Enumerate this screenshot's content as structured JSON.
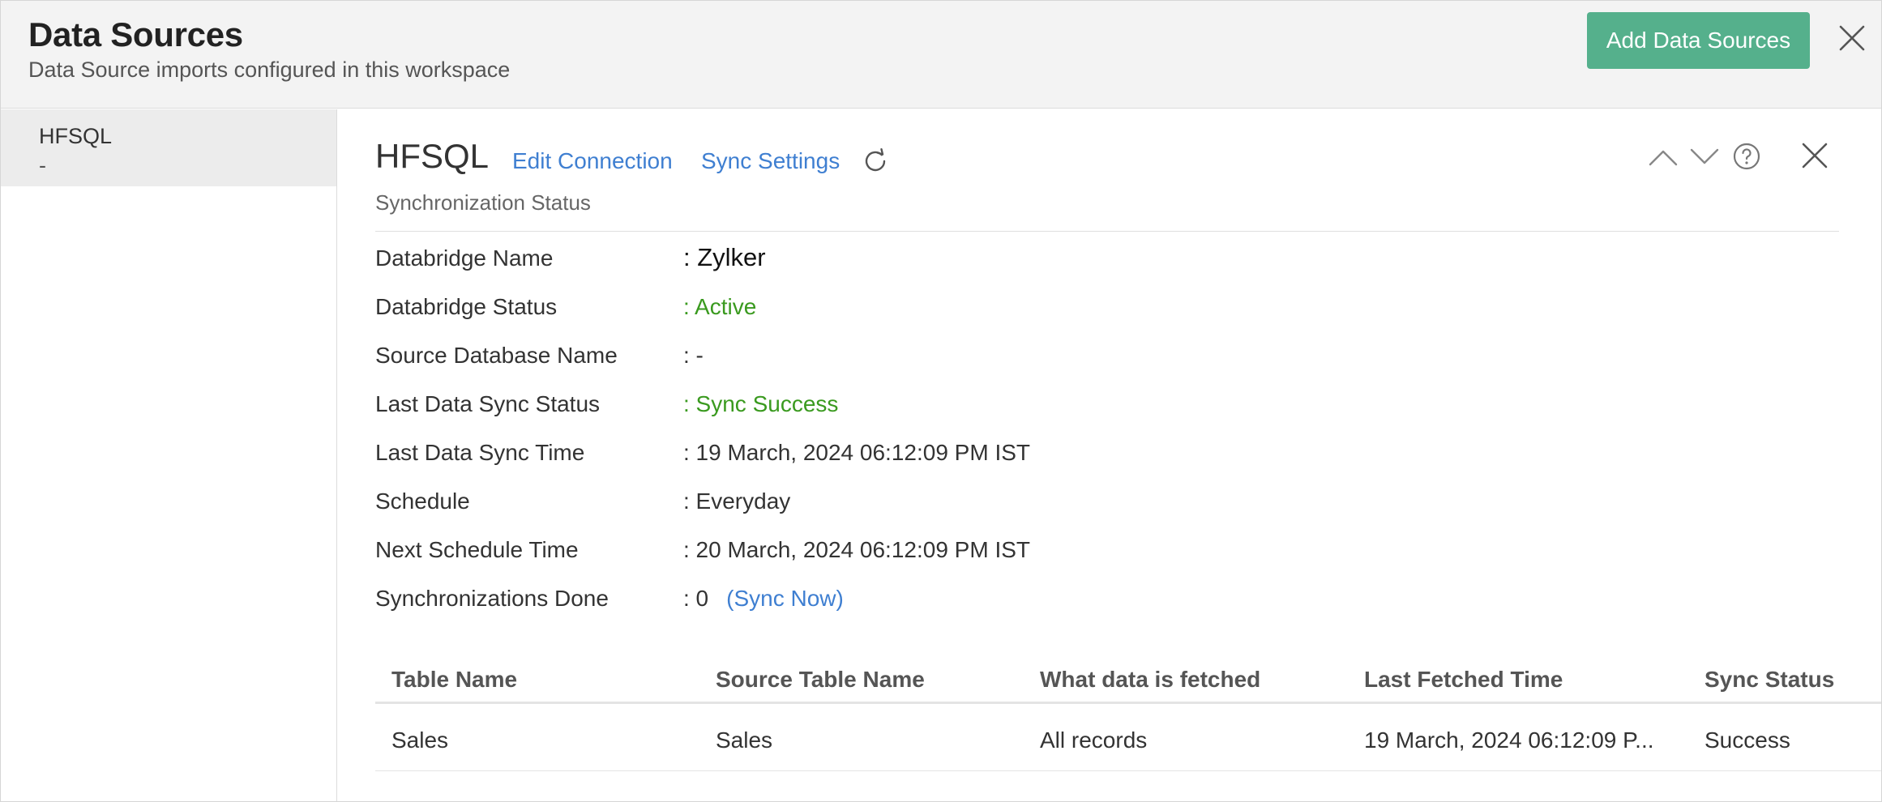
{
  "header": {
    "title": "Data Sources",
    "subtitle": "Data Source imports configured in this workspace",
    "add_button_label": "Add Data Sources"
  },
  "sidebar": {
    "items": [
      {
        "name": "HFSQL",
        "sub": "-"
      }
    ]
  },
  "panel": {
    "title": "HFSQL",
    "edit_connection": "Edit Connection",
    "sync_settings": "Sync Settings",
    "section_label": "Synchronization Status",
    "details": {
      "databridge_name": {
        "label": "Databridge Name",
        "value": ": Zylker"
      },
      "databridge_status": {
        "label": "Databridge Status",
        "value": ": Active"
      },
      "source_db_name": {
        "label": "Source Database Name",
        "value": ": -"
      },
      "last_sync_status": {
        "label": "Last Data Sync Status",
        "value": ": Sync Success"
      },
      "last_sync_time": {
        "label": "Last Data Sync Time",
        "value": ": 19 March, 2024 06:12:09 PM IST"
      },
      "schedule": {
        "label": "Schedule",
        "value": ": Everyday"
      },
      "next_schedule_time": {
        "label": "Next Schedule Time",
        "value": ": 20 March, 2024 06:12:09 PM IST"
      },
      "syncs_done": {
        "label": "Synchronizations Done",
        "value": ": 0",
        "sync_now": "(Sync Now)"
      }
    },
    "table": {
      "columns": [
        "Table Name",
        "Source Table Name",
        "What data is fetched",
        "Last Fetched Time",
        "Sync Status"
      ],
      "rows": [
        [
          "Sales",
          "Sales",
          "All records",
          "19 March, 2024 06:12:09 P...",
          "Success"
        ]
      ]
    }
  },
  "icons": {
    "close": "close-icon",
    "refresh": "refresh-icon",
    "chevron_up": "chevron-up-icon",
    "chevron_down": "chevron-down-icon",
    "help": "help-icon"
  },
  "colors": {
    "accent_button": "#55b08c",
    "link": "#3f7fd1",
    "status_green": "#3a9a1f"
  }
}
